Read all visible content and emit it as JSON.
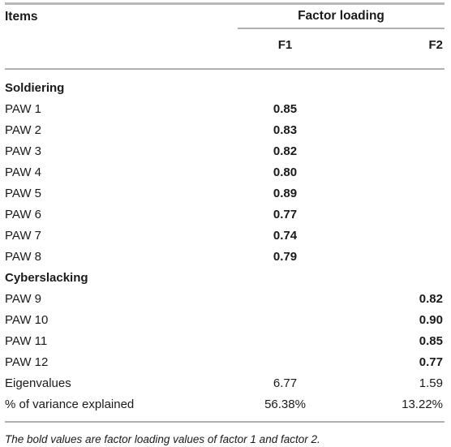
{
  "table": {
    "header": {
      "items_label": "Items",
      "group_label": "Factor loading",
      "col_f1": "F1",
      "col_f2": "F2"
    },
    "rows": [
      {
        "label": "Soldiering",
        "f1": "",
        "f2": "",
        "type": "group",
        "bold_f1": false,
        "bold_f2": false
      },
      {
        "label": "PAW 1",
        "f1": "0.85",
        "f2": "",
        "type": "item",
        "bold_f1": true,
        "bold_f2": false
      },
      {
        "label": "PAW 2",
        "f1": "0.83",
        "f2": "",
        "type": "item",
        "bold_f1": true,
        "bold_f2": false
      },
      {
        "label": "PAW 3",
        "f1": "0.82",
        "f2": "",
        "type": "item",
        "bold_f1": true,
        "bold_f2": false
      },
      {
        "label": "PAW 4",
        "f1": "0.80",
        "f2": "",
        "type": "item",
        "bold_f1": true,
        "bold_f2": false
      },
      {
        "label": "PAW 5",
        "f1": "0.89",
        "f2": "",
        "type": "item",
        "bold_f1": true,
        "bold_f2": false
      },
      {
        "label": "PAW 6",
        "f1": "0.77",
        "f2": "",
        "type": "item",
        "bold_f1": true,
        "bold_f2": false
      },
      {
        "label": "PAW 7",
        "f1": "0.74",
        "f2": "",
        "type": "item",
        "bold_f1": true,
        "bold_f2": false
      },
      {
        "label": "PAW 8",
        "f1": "0.79",
        "f2": "",
        "type": "item",
        "bold_f1": true,
        "bold_f2": false
      },
      {
        "label": "Cyberslacking",
        "f1": "",
        "f2": "",
        "type": "group",
        "bold_f1": false,
        "bold_f2": false
      },
      {
        "label": "PAW 9",
        "f1": "",
        "f2": "0.82",
        "type": "item",
        "bold_f1": false,
        "bold_f2": true
      },
      {
        "label": "PAW 10",
        "f1": "",
        "f2": "0.90",
        "type": "item",
        "bold_f1": false,
        "bold_f2": true
      },
      {
        "label": "PAW 11",
        "f1": "",
        "f2": "0.85",
        "type": "item",
        "bold_f1": false,
        "bold_f2": true
      },
      {
        "label": "PAW 12",
        "f1": "",
        "f2": "0.77",
        "type": "item",
        "bold_f1": false,
        "bold_f2": true
      },
      {
        "label": "Eigenvalues",
        "f1": "6.77",
        "f2": "1.59",
        "type": "stat",
        "bold_f1": false,
        "bold_f2": false
      },
      {
        "label": "% of variance explained",
        "f1": "56.38%",
        "f2": "13.22%",
        "type": "stat",
        "bold_f1": false,
        "bold_f2": false
      }
    ],
    "footnote": "The bold values are factor loading values of factor 1 and factor 2."
  }
}
